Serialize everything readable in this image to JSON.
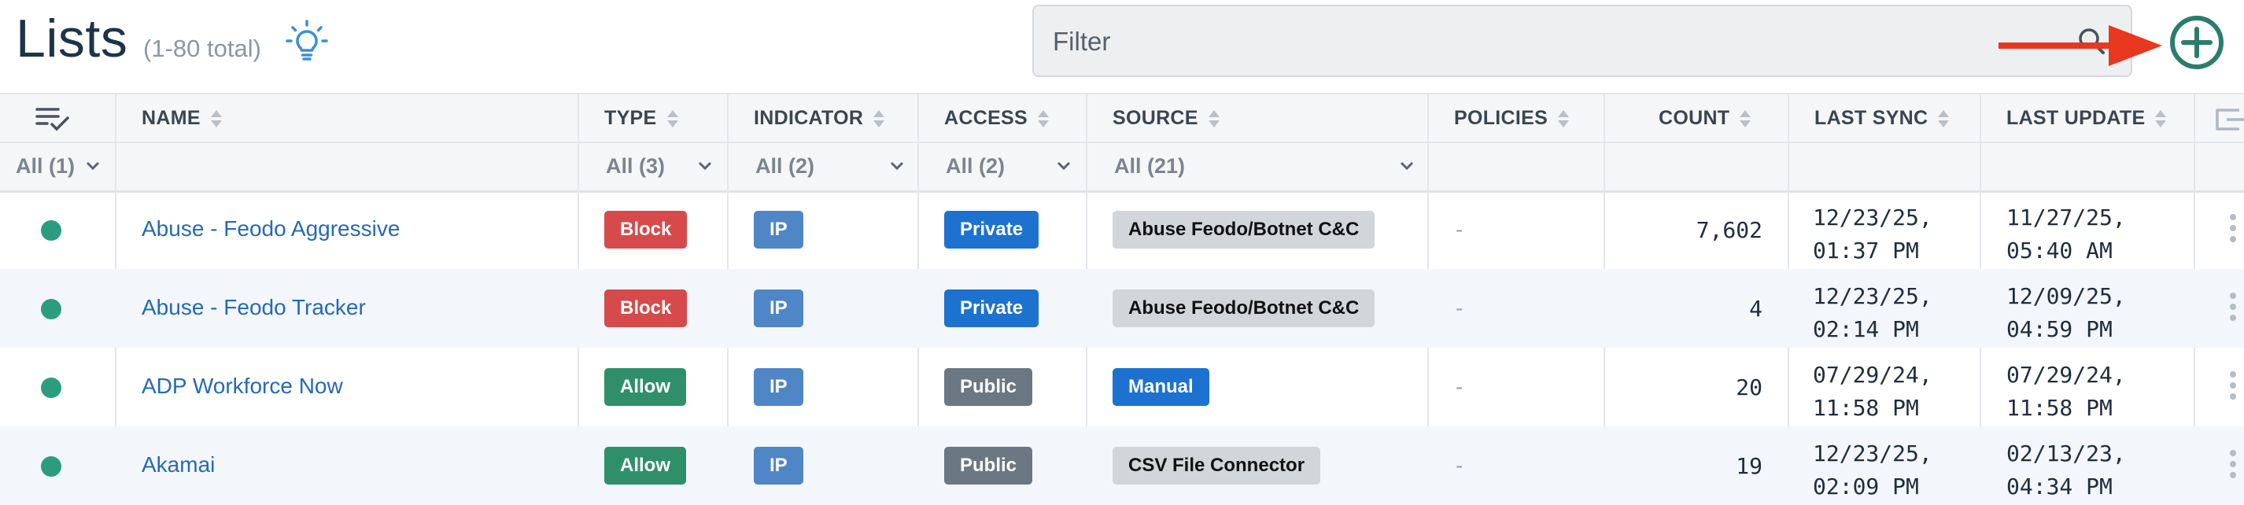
{
  "header": {
    "title": "Lists",
    "subtitle": "(1-80 total)",
    "filter_placeholder": "Filter"
  },
  "colors": {
    "accent": "#2a7d6b",
    "annotation_arrow": "#e8371f",
    "link": "#2569b8",
    "status_dot": "#2a9d7f"
  },
  "table": {
    "columns": [
      "NAME",
      "TYPE",
      "INDICATOR",
      "ACCESS",
      "SOURCE",
      "POLICIES",
      "COUNT",
      "LAST SYNC",
      "LAST UPDATE"
    ],
    "filters": {
      "status": "All (1)",
      "type": "All (3)",
      "indicator": "All (2)",
      "access": "All (2)",
      "source": "All (21)"
    },
    "rows": [
      {
        "name": "Abuse - Feodo Aggressive",
        "type": "Block",
        "indicator": "IP",
        "access": "Private",
        "source": "Abuse Feodo/Botnet C&C",
        "policies": "-",
        "count": "7,602",
        "last_sync": "12/23/25,\n01:37 PM",
        "last_update": "11/27/25,\n05:40 AM"
      },
      {
        "name": "Abuse - Feodo Tracker",
        "type": "Block",
        "indicator": "IP",
        "access": "Private",
        "source": "Abuse Feodo/Botnet C&C",
        "policies": "-",
        "count": "4",
        "last_sync": "12/23/25,\n02:14 PM",
        "last_update": "12/09/25,\n04:59 PM"
      },
      {
        "name": "ADP Workforce Now",
        "type": "Allow",
        "indicator": "IP",
        "access": "Public",
        "source": "Manual",
        "policies": "-",
        "count": "20",
        "last_sync": "07/29/24,\n11:58 PM",
        "last_update": "07/29/24,\n11:58 PM"
      },
      {
        "name": "Akamai",
        "type": "Allow",
        "indicator": "IP",
        "access": "Public",
        "source": "CSV File Connector",
        "policies": "-",
        "count": "19",
        "last_sync": "12/23/25,\n02:09 PM",
        "last_update": "02/13/23,\n04:34 PM"
      }
    ]
  },
  "icons": {
    "bulb": "lightbulb-icon",
    "search": "search-icon",
    "add": "add-circle-icon",
    "columns": "column-select-icon",
    "export": "export-icon"
  }
}
